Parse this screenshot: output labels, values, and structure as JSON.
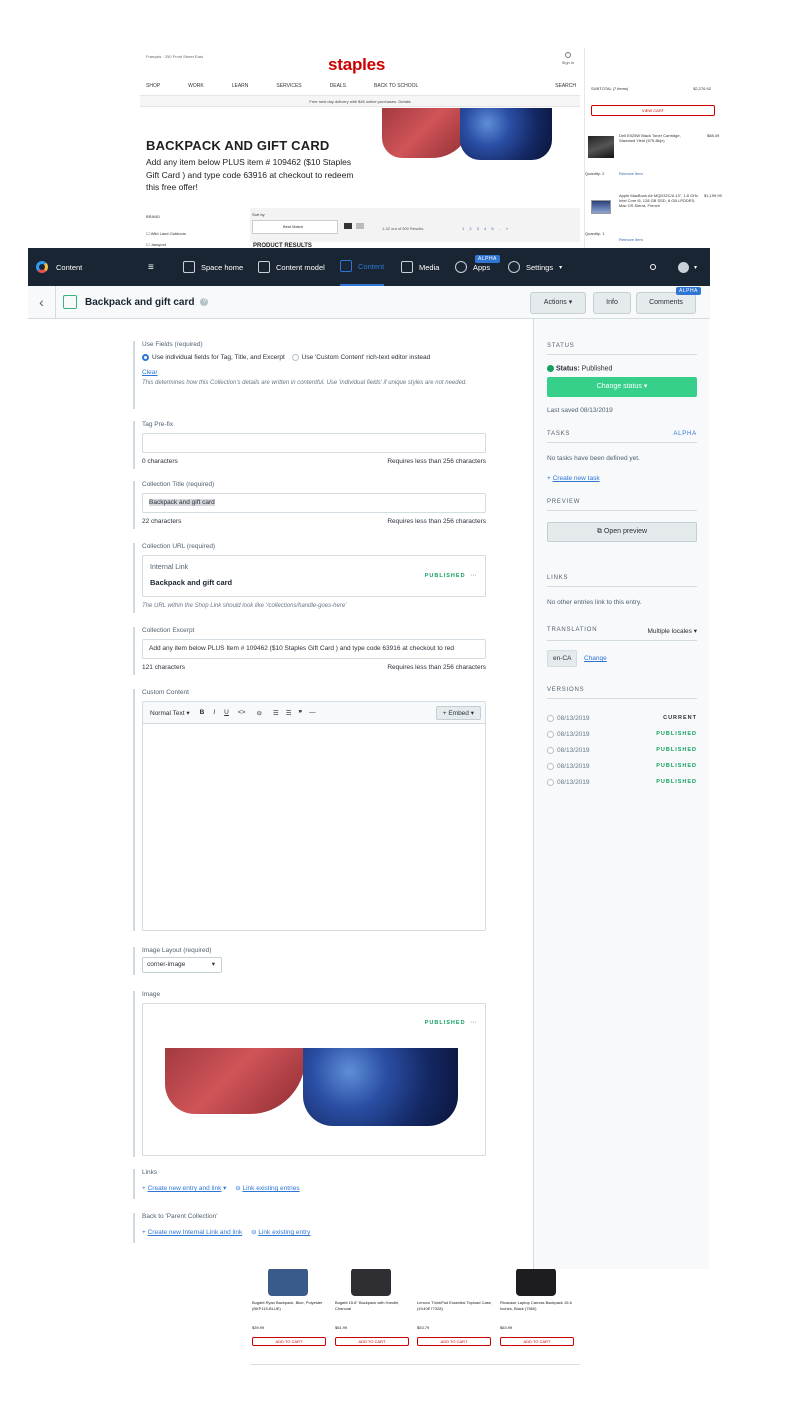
{
  "staples": {
    "lang": "Français",
    "store": "250 Front Street East",
    "logo": "staples",
    "sign_in": "Sign In",
    "cart": "Cart",
    "nav": [
      "SHOP",
      "WORK",
      "LEARN",
      "SERVICES",
      "DEALS",
      "BACK TO SCHOOL",
      "SEARCH"
    ],
    "promo": "Free next day delivery with $45 online purchases. Details",
    "heading": "BACKPACK AND GIFT CARD",
    "description": "Add any item below PLUS item # 109462 ($10 Staples Gift Card ) and type code 63916 at checkout to redeem this free offer!",
    "brand_label": "BRAND",
    "brand_items": [
      "Wild Land Outdoors",
      "Jansport"
    ],
    "sort_label": "Sort by",
    "sort_value": "Best Match",
    "results_count": "1-32 out of 500 Results",
    "pages": "1 2 3 4 5 .. »",
    "product_results": "PRODUCT RESULTS",
    "cart_panel": {
      "subtotal": "SUBTOTAL (7 items)",
      "subtotal_value": "$2,276.92",
      "view_cart": "VIEW CART",
      "item1_name": "Dell E525W Black Toner Cartridge, Standard Yield (575-Bbjx)",
      "item1_price": "$88.49",
      "item1_qty": "Quantity: 2",
      "remove": "Remove Item",
      "item2_name": "Apple MacBook Air MQD32C/A 13\", 1.8 GHz Intel Core i5, 128 GB SSD, 8 GB LPDDR3, Mac OS Sierra, French",
      "item2_price": "$1,199.99",
      "item2_qty": "Quantity: 1"
    },
    "products": [
      {
        "name": "Bugatti Ryan Backpack, Blue, Polyester (BKP115-BLUE)",
        "price": "$39.99",
        "add": "ADD TO CART"
      },
      {
        "name": "Bugatti 15.6\" Backpack with Handle, Charcoal",
        "price": "$61.99",
        "add": "ADD TO CART"
      },
      {
        "name": "Lenovo ThinkPad Essential Topload Case, (4X40E77328)",
        "price": "$53.79",
        "add": "ADD TO CART"
      },
      {
        "name": "Rivacase Laptop Canvas Backpack 15.6 Inches, Black (7560)",
        "price": "$63.99",
        "add": "ADD TO CART"
      }
    ]
  },
  "topbar": {
    "app": "Content",
    "items": [
      "Space home",
      "Content model",
      "Content",
      "Media",
      "Apps",
      "Settings"
    ],
    "apps_badge": "ALPHA"
  },
  "entry": {
    "title": "Backpack and gift card",
    "actions": "Actions",
    "info": "Info",
    "comments": "Comments",
    "comments_badge": "ALPHA"
  },
  "fields": {
    "use_fields_label": "Use Fields (required)",
    "radio1": "Use individual fields for Tag, Title, and Excerpt",
    "radio2": "Use 'Custom Content' rich-text editor instead",
    "clear": "Clear",
    "use_fields_note": "This determines how this Collection's details are written in contentful. Use 'individual fields' if unique styles are not needed.",
    "tag_label": "Tag Pre-fix",
    "tag_count": "0 characters",
    "limit": "Requires less than 256 characters",
    "title_label": "Collection Title (required)",
    "title_value": "Backpack and gift card",
    "title_count": "22 characters",
    "url_label": "Collection URL (required)",
    "url_card_type": "Internal Link",
    "url_card_title": "Backpack and gift card",
    "published": "PUBLISHED",
    "url_note": "The URL within the Shop Link should look like '/collections/handle-goes-here'",
    "excerpt_label": "Collection Excerpt",
    "excerpt_value": "Add any item below PLUS Item # 109462 ($10 Staples Gift Card ) and type code 63916 at checkout to red",
    "excerpt_count": "121 characters",
    "custom_label": "Custom Content",
    "toolbar_style": "Normal Text",
    "embed": "+ Embed",
    "layout_label": "Image Layout (required)",
    "layout_value": "corner-image",
    "image_label": "Image",
    "links_label": "Links",
    "create_entry": "Create new entry and link",
    "link_existing": "Link existing entries",
    "back_label": "Back to 'Parent Collection'",
    "create_internal": "Create new Internal Link and link",
    "link_existing_one": "Link existing entry"
  },
  "sidebar": {
    "status_h": "STATUS",
    "status_label": "Status:",
    "status_value": "Published",
    "change_status": "Change status",
    "last_saved": "Last saved 08/13/2019",
    "tasks_h": "TASKS",
    "tasks_badge": "ALPHA",
    "no_tasks": "No tasks have been defined yet.",
    "create_task": "Create new task",
    "preview_h": "PREVIEW",
    "open_preview": "Open preview",
    "links_h": "LINKS",
    "no_links": "No other entries link to this entry.",
    "translation_h": "TRANSLATION",
    "locales": "Multiple locales",
    "locale": "en-CA",
    "change": "Change",
    "versions_h": "VERSIONS",
    "versions": [
      {
        "date": "08/13/2019",
        "state": "CURRENT"
      },
      {
        "date": "08/13/2019",
        "state": "PUBLISHED"
      },
      {
        "date": "08/13/2019",
        "state": "PUBLISHED"
      },
      {
        "date": "08/13/2019",
        "state": "PUBLISHED"
      },
      {
        "date": "08/13/2019",
        "state": "PUBLISHED"
      }
    ]
  },
  "colors": {
    "brand_red": "#cc0000",
    "contentful_nav": "#192532",
    "accent_blue": "#2e75d4",
    "published_green": "#14a05e",
    "status_btn": "#36d08a"
  }
}
